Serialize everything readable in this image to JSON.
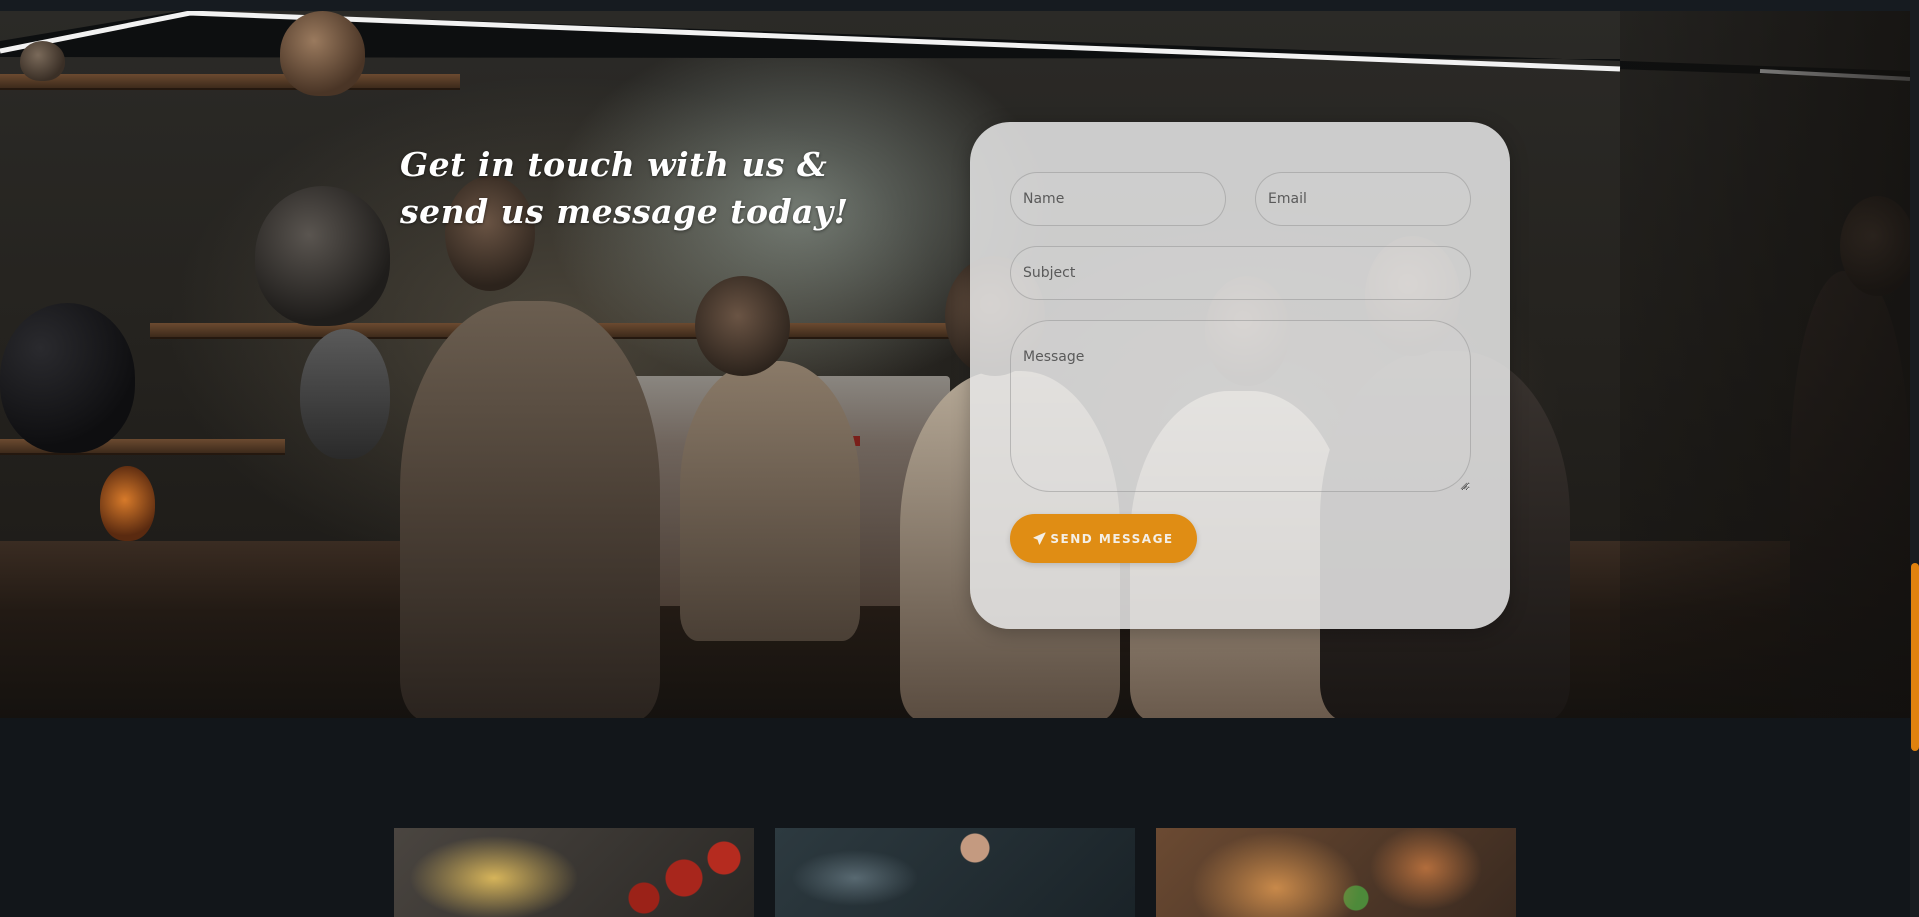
{
  "hero": {
    "title_line_1": "Get in touch with us &",
    "title_line_2": "send us message today!"
  },
  "contact_form": {
    "name_placeholder": "Name",
    "email_placeholder": "Email",
    "subject_placeholder": "Subject",
    "message_placeholder": "Message",
    "send_label": "SEND MESSAGE",
    "send_icon": "paper-plane-icon"
  },
  "colors": {
    "accent": "#e08d14",
    "page_background": "#12161a",
    "form_card": "#e8e8e8",
    "scrollbar_thumb": "#e0820f"
  },
  "thumbnails": [
    {
      "subject": "pasta-and-tomatoes"
    },
    {
      "subject": "chef-cooking"
    },
    {
      "subject": "pizza"
    }
  ]
}
